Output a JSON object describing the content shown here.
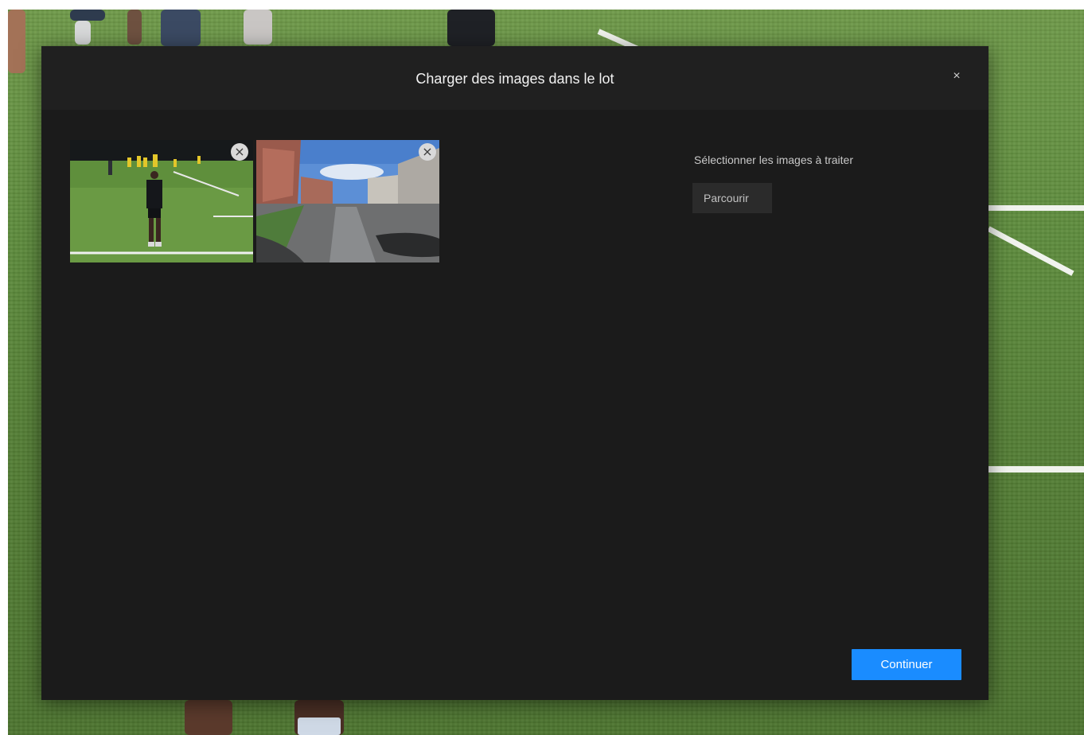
{
  "dialog": {
    "title": "Charger des images dans le lot",
    "close_icon": "×",
    "select_label": "Sélectionner les images à traiter",
    "browse_label": "Parcourir",
    "continue_label": "Continuer"
  },
  "thumbnails": [
    {
      "remove_icon": "×"
    },
    {
      "remove_icon": "×"
    }
  ],
  "colors": {
    "dialog_bg": "#1b1b1b",
    "header_bg": "#202020",
    "accent": "#1a8cff"
  }
}
